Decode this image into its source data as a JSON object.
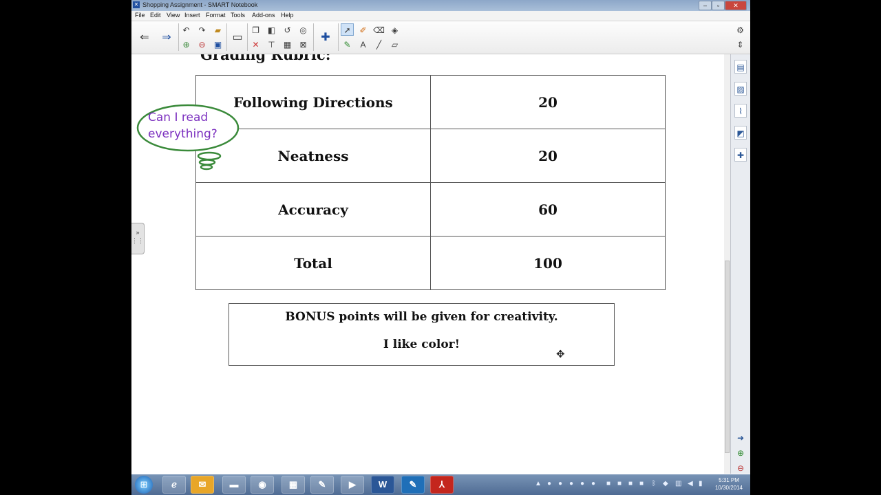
{
  "window": {
    "title": "Shopping Assignment - SMART Notebook",
    "app_icon": "smart-notebook-icon",
    "controls": [
      "–",
      "▫",
      "✕"
    ]
  },
  "menu": [
    "File",
    "Edit",
    "View",
    "Insert",
    "Format",
    "Tools",
    "Add-ons",
    "Help"
  ],
  "document": {
    "heading": "Grading Rubric:",
    "rubric": [
      {
        "criterion": "Following Directions",
        "points": "20"
      },
      {
        "criterion": "Neatness",
        "points": "20"
      },
      {
        "criterion": "Accuracy",
        "points": "60"
      },
      {
        "criterion": "Total",
        "points": "100"
      }
    ],
    "bonus": {
      "line1": "BONUS points will be given for creativity.",
      "line2": "I like color!"
    },
    "thought_bubble": {
      "line1": "Can I read",
      "line2": "everything?"
    }
  },
  "colors": {
    "thought_bubble_outline": "#3a8a3a",
    "thought_bubble_text": "#7b2fbf"
  },
  "taskbar": {
    "apps": [
      "ie-icon",
      "outlook-icon",
      "explorer-icon",
      "chrome-icon",
      "calculator-icon",
      "paint-icon",
      "media-player-icon",
      "word-icon",
      "smart-notebook-icon",
      "acrobat-icon"
    ],
    "word_label": "W",
    "clock": {
      "time": "5:31 PM",
      "date": "10/30/2014"
    }
  }
}
